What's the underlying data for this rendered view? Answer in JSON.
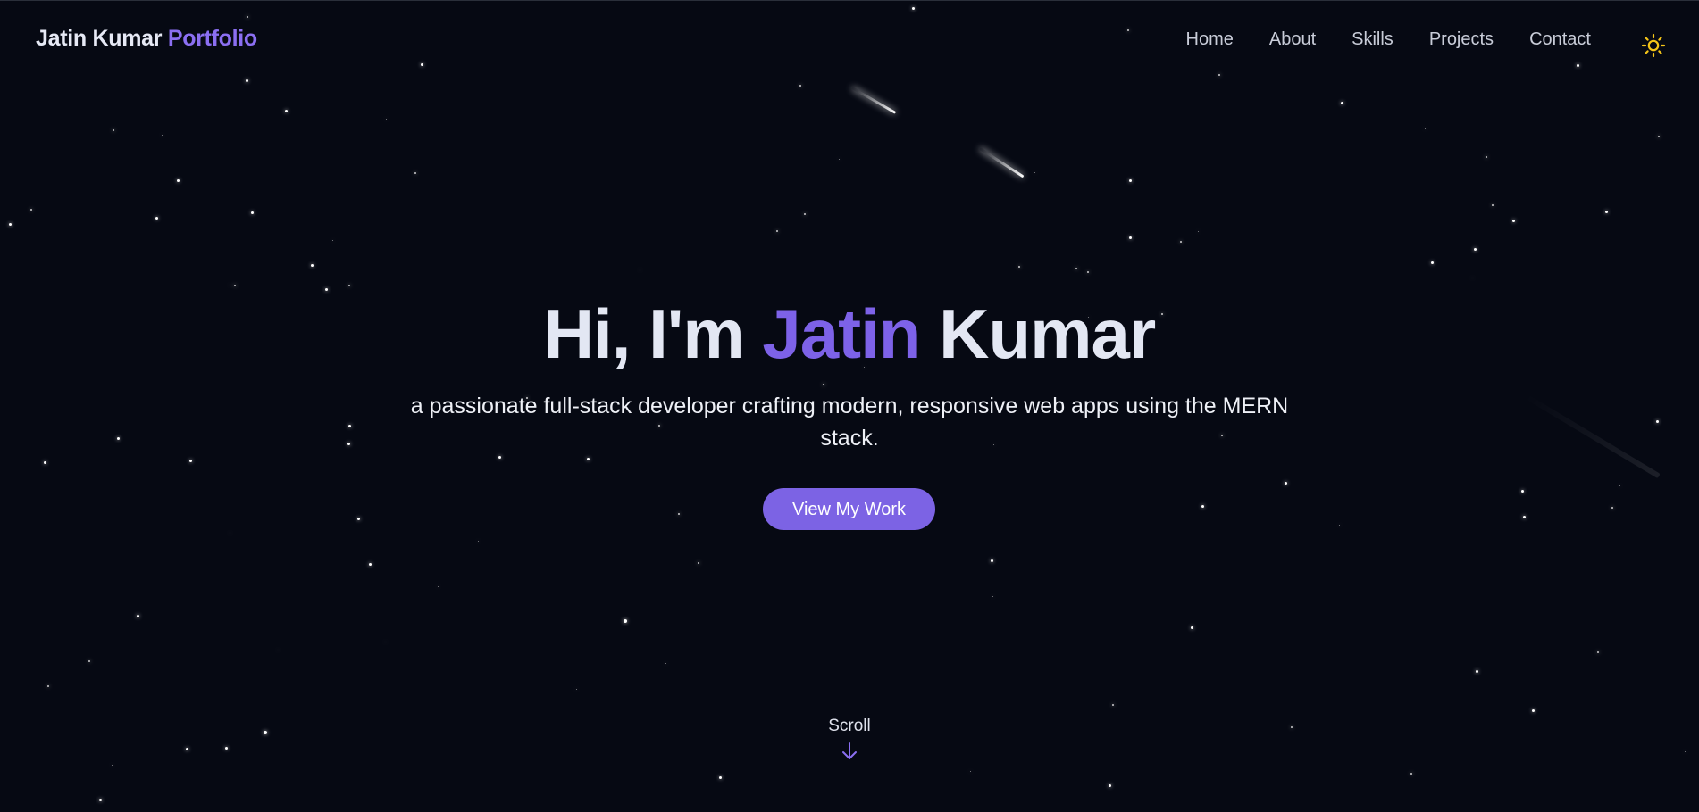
{
  "header": {
    "brand_name": "Jatin Kumar",
    "brand_accent": "Portfolio",
    "nav": [
      {
        "label": "Home"
      },
      {
        "label": "About"
      },
      {
        "label": "Skills"
      },
      {
        "label": "Projects"
      },
      {
        "label": "Contact"
      }
    ],
    "theme_toggle_icon": "sun-icon"
  },
  "hero": {
    "greeting": "Hi, I'm",
    "first_name": "Jatin",
    "last_name": "Kumar",
    "subtitle": "a passionate full-stack developer crafting modern, responsive web apps using the MERN stack.",
    "cta_label": "View My Work"
  },
  "scroll": {
    "label": "Scroll",
    "icon": "arrow-down-icon"
  },
  "colors": {
    "background": "#060913",
    "accent": "#7d62e8",
    "text": "#e3e7f3",
    "sun": "#f5c518"
  }
}
